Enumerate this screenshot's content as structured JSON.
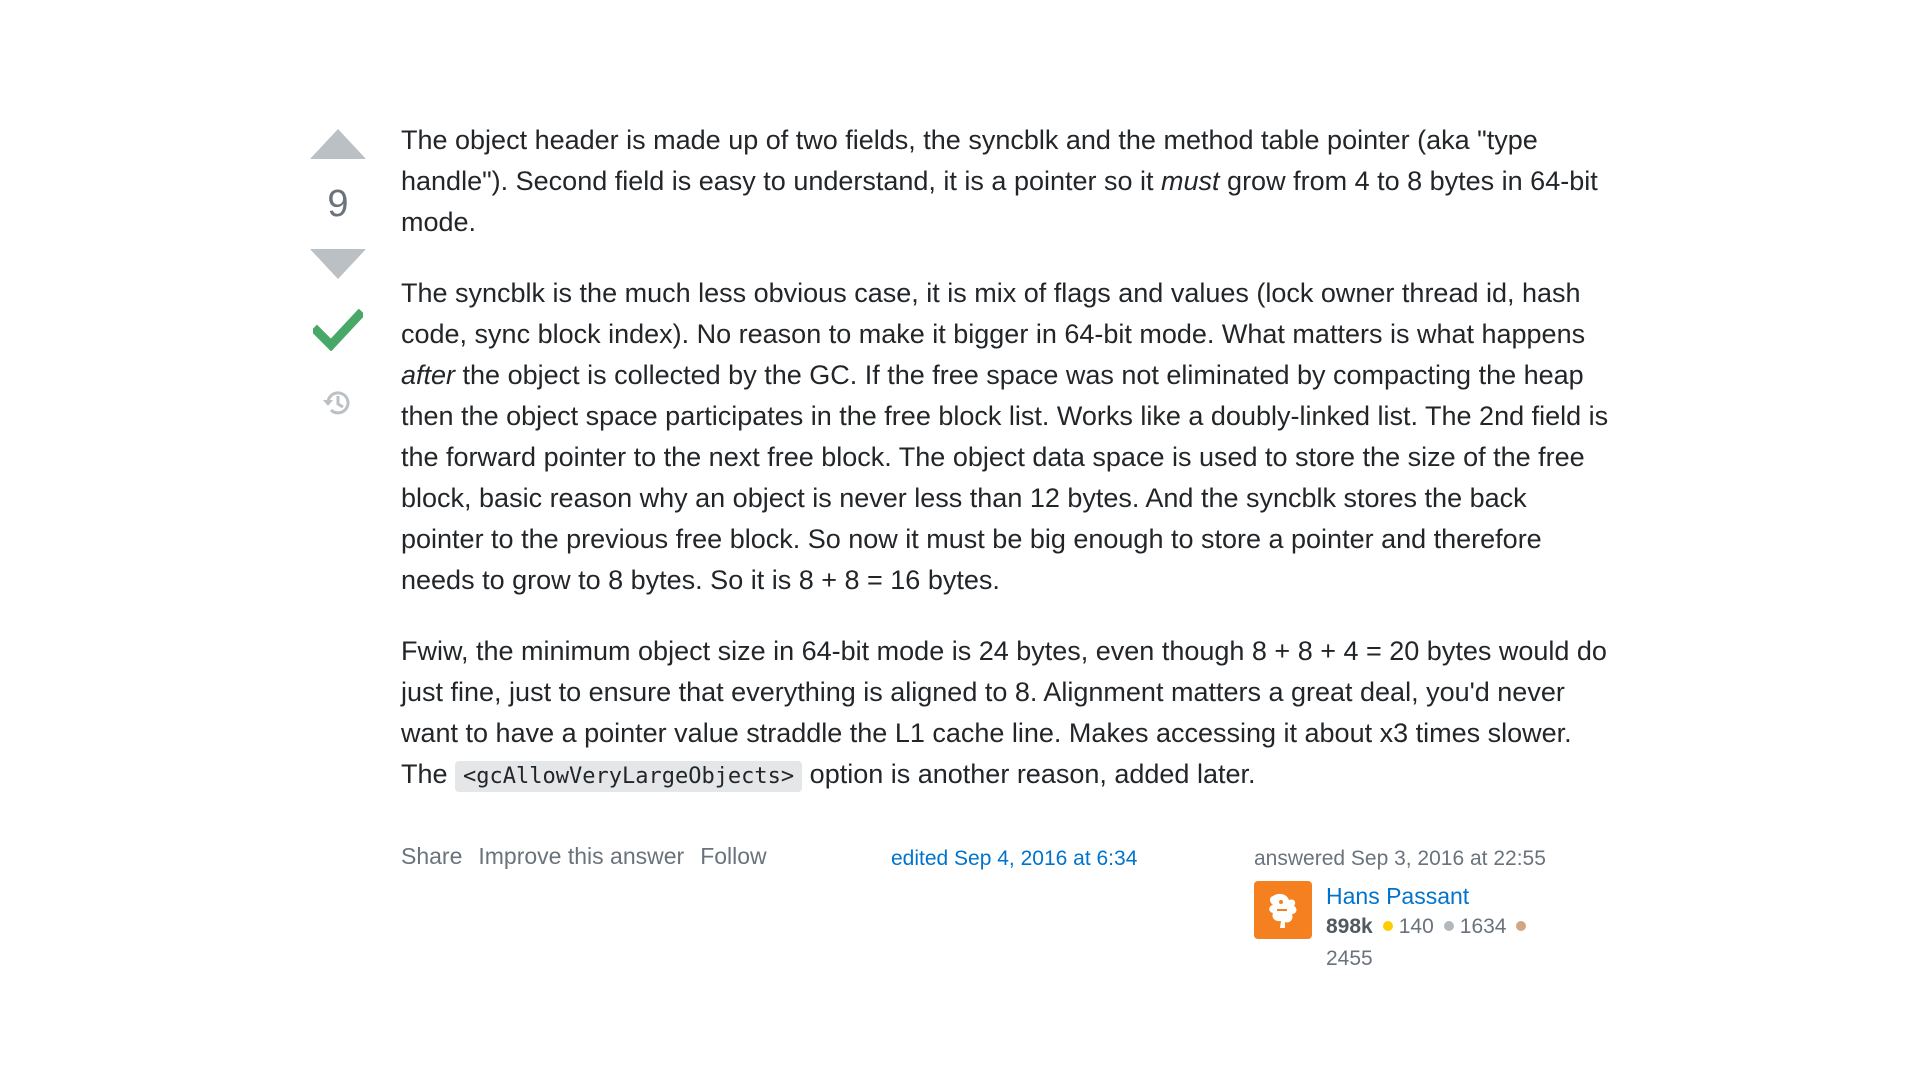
{
  "votes": {
    "count": "9",
    "upvote_icon": "triangle-up-icon",
    "downvote_icon": "triangle-down-icon",
    "accepted_icon": "checkmark-icon",
    "history_icon": "history-icon",
    "colors": {
      "arrow": "#bbc0c4",
      "accepted": "#48a868"
    }
  },
  "post": {
    "p1": {
      "part1": "The object header is made up of two fields, the syncblk and the method table pointer (aka \"type handle\"). Second field is easy to understand, it is a pointer so it ",
      "em": "must",
      "part2": " grow from 4 to 8 bytes in 64-bit mode."
    },
    "p2": {
      "part1": "The syncblk is the much less obvious case, it is mix of flags and values (lock owner thread id, hash code, sync block index). No reason to make it bigger in 64-bit mode. What matters is what happens ",
      "em": "after",
      "part2": " the object is collected by the GC. If the free space was not eliminated by compacting the heap then the object space participates in the free block list. Works like a doubly-linked list. The 2nd field is the forward pointer to the next free block. The object data space is used to store the size of the free block, basic reason why an object is never less than 12 bytes. And the syncblk stores the back pointer to the previous free block. So now it must be big enough to store a pointer and therefore needs to grow to 8 bytes. So it is 8 + 8 = 16 bytes."
    },
    "p3": {
      "part1": "Fwiw, the minimum object size in 64-bit mode is 24 bytes, even though 8 + 8 + 4 = 20 bytes would do just fine, just to ensure that everything is aligned to 8. Alignment matters a great deal, you'd never want to have a pointer value straddle the L1 cache line. Makes accessing it about x3 times slower. The ",
      "code": "<gcAllowVeryLargeObjects>",
      "part2": " option is another reason, added later."
    }
  },
  "footer": {
    "menu": {
      "share": "Share",
      "improve": "Improve this answer",
      "follow": "Follow"
    },
    "edited": "edited Sep 4, 2016 at 6:34",
    "answered": "answered Sep 3, 2016 at 22:55",
    "user": {
      "name": "Hans Passant",
      "reputation": "898k",
      "gold": "140",
      "silver": "1634",
      "bronze": "2455",
      "avatar_icon": "lion-avatar-icon",
      "colors": {
        "avatar_bg": "#f4801f",
        "gold": "#ffcc01",
        "silver": "#b4b8bc",
        "bronze": "#d1a684"
      }
    }
  }
}
